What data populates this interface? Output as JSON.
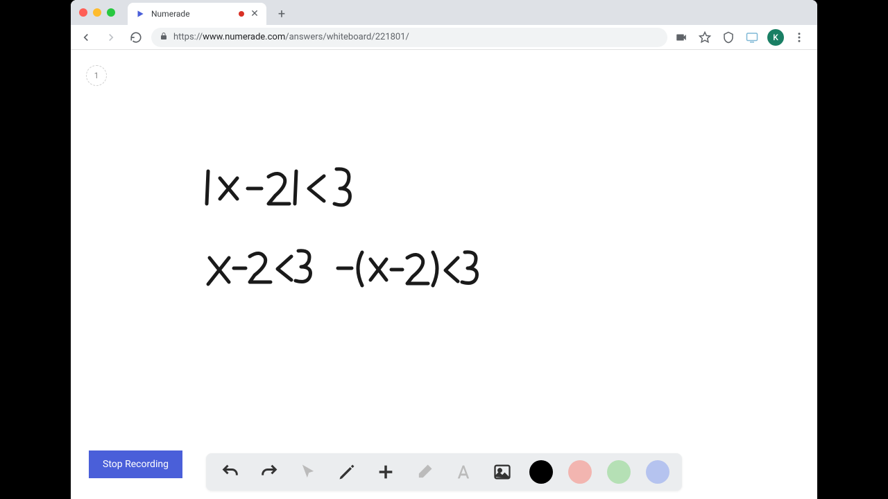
{
  "tab": {
    "title": "Numerade",
    "recording": true
  },
  "address": {
    "scheme": "https://",
    "host": "www.numerade.com",
    "path": "/answers/whiteboard/221801/"
  },
  "avatar_initial": "K",
  "page_badge": "1",
  "stop_button_label": "Stop Recording",
  "whiteboard": {
    "line1": "|x - 2| < 3",
    "line2a": "x - 2 < 3",
    "line2b": "-(x - 2) < 3"
  },
  "toolbar_tools": {
    "undo": "undo",
    "redo": "redo",
    "pointer": "pointer",
    "pen": "pen",
    "add": "add",
    "eraser": "eraser",
    "text": "text",
    "image": "image"
  },
  "colors": {
    "black": "#000000",
    "red": "#f2b5b0",
    "green": "#b5e0b5",
    "blue": "#b5c3ef"
  }
}
